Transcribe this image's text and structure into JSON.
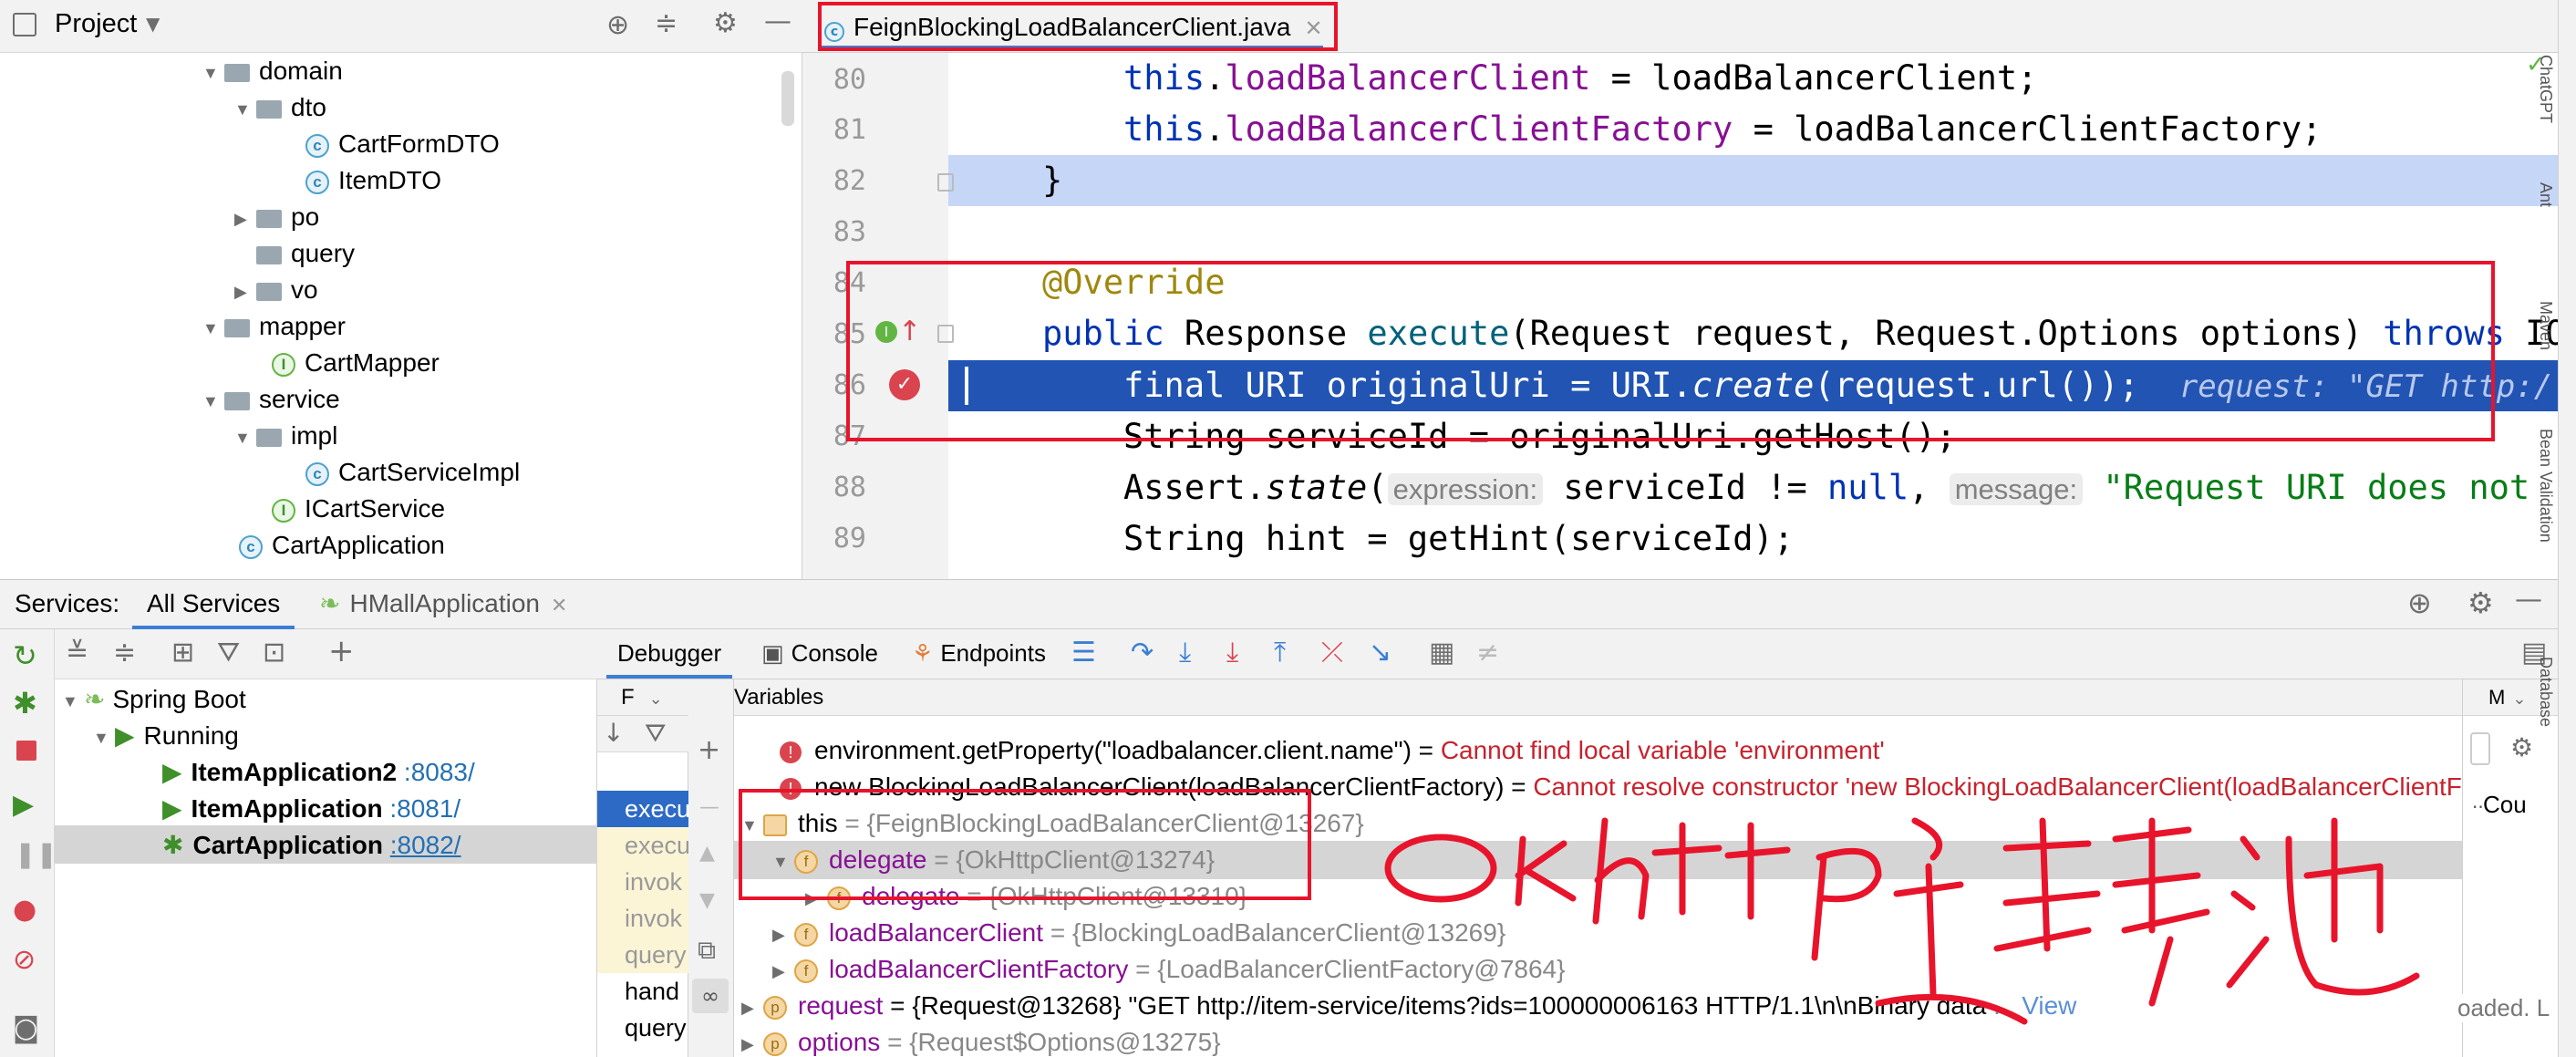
{
  "project": {
    "title": "Project",
    "tree": [
      {
        "label": "domain",
        "kind": "folder"
      },
      {
        "label": "dto",
        "kind": "folder"
      },
      {
        "label": "CartFormDTO",
        "kind": "class"
      },
      {
        "label": "ItemDTO",
        "kind": "class"
      },
      {
        "label": "po",
        "kind": "folder"
      },
      {
        "label": "query",
        "kind": "folder"
      },
      {
        "label": "vo",
        "kind": "folder"
      },
      {
        "label": "mapper",
        "kind": "folder"
      },
      {
        "label": "CartMapper",
        "kind": "interface"
      },
      {
        "label": "service",
        "kind": "folder"
      },
      {
        "label": "impl",
        "kind": "folder"
      },
      {
        "label": "CartServiceImpl",
        "kind": "class"
      },
      {
        "label": "ICartService",
        "kind": "interface"
      },
      {
        "label": "CartApplication",
        "kind": "class"
      }
    ]
  },
  "editor": {
    "tab": "FeignBlockingLoadBalancerClient.java",
    "line_numbers": [
      "80",
      "81",
      "82",
      "83",
      "84",
      "85",
      "86",
      "87",
      "88",
      "89"
    ],
    "l80_this": "this",
    "l80_field": "loadBalancerClient",
    "l80_rest": " = loadBalancerClient;",
    "l81_this": "this",
    "l81_field": "loadBalancerClientFactory",
    "l81_rest": " = loadBalancerClientFactory;",
    "l82": "}",
    "l84_ann": "@Override",
    "l85_public": "public",
    "l85_type": " Response ",
    "l85_method": "execute",
    "l85_params": "(Request request, Request.Options options) ",
    "l85_throws": "throws",
    "l85_tail": " IO",
    "l86_code": "final URI originalUri = URI.",
    "l86_create": "create",
    "l86_rest": "(request.url());",
    "l86_hint": "request: \"GET http:/",
    "l87": "String serviceId = originalUri.getHost();",
    "l88_pre": "Assert.",
    "l88_state": "state",
    "l88_paren": "(",
    "l88_hint1": "expression:",
    "l88_mid": " serviceId != ",
    "l88_null": "null",
    "l88_comma": ", ",
    "l88_hint2": "message:",
    "l88_str": " \"Request URI does not",
    "l89": "String hint = getHint(serviceId);"
  },
  "services": {
    "label": "Services:",
    "tab_all": "All Services",
    "tab_app": "HMallApplication",
    "tree": {
      "spring_boot": "Spring Boot",
      "running": "Running",
      "apps": [
        {
          "name": "ItemApplication2",
          "port": ":8083/"
        },
        {
          "name": "ItemApplication",
          "port": ":8081/"
        },
        {
          "name": "CartApplication",
          "port": ":8082/"
        }
      ]
    }
  },
  "debugger": {
    "tab_debugger": "Debugger",
    "tab_console": "Console",
    "tab_endpoints": "Endpoints",
    "frames_label": "F",
    "frames": [
      "execu",
      "execu",
      "invok",
      "invok",
      "query",
      "hand",
      "query"
    ],
    "variables_label": "Variables",
    "right_label": "M",
    "right_tail": "Cou",
    "right_loaded": "oaded. L",
    "vars": {
      "err1_expr": "environment.getProperty(\"loadbalancer.client.name\") = ",
      "err1_msg": "Cannot find local variable 'environment'",
      "err2_expr": "new BlockingLoadBalancerClient(loadBalancerClientFactory) = ",
      "err2_msg": "Cannot resolve constructor 'new BlockingLoadBalancerClient(loadBalancerClientFac",
      "this_name": "this",
      "this_val": " = {FeignBlockingLoadBalancerClient@13267}",
      "delegate_name": "delegate",
      "delegate_val": " = {OkHttpClient@13274}",
      "delegate2_name": "delegate",
      "delegate2_val": " = {OkHttpClient@13310}",
      "lbc_name": "loadBalancerClient",
      "lbc_val": " = {BlockingLoadBalancerClient@13269}",
      "lbcf_name": "loadBalancerClientFactory",
      "lbcf_val": " = {LoadBalancerClientFactory@7864}",
      "req_name": "request",
      "req_val": " = {Request@13268} \"GET http://item-service/items?ids=100000006163 HTTP/1.1\\n\\nBinary data",
      "req_view": "... View",
      "opt_name": "options",
      "opt_val": " = {Request$Options@13275}"
    }
  },
  "right_tools": [
    "ChatGPT",
    "Ant",
    "Maven",
    "Bean Validation",
    "Database"
  ],
  "annotation_handwriting": "okhttp连接池",
  "colors": {
    "highlight_red": "#e8142b",
    "selected_line": "#2154b3",
    "exec_line_bg": "#c6d6f7"
  }
}
